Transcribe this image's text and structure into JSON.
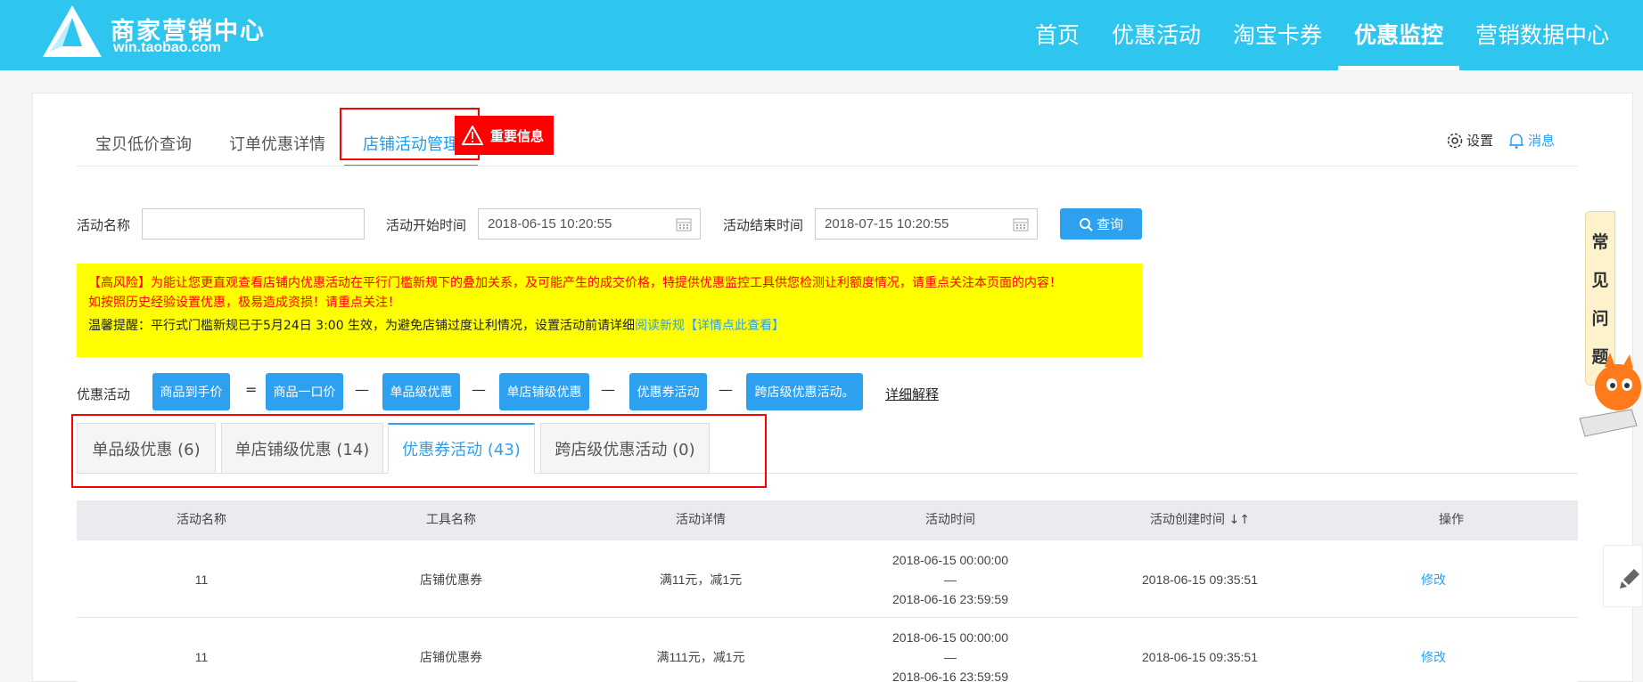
{
  "header": {
    "logo_title": "商家营销中心",
    "logo_sub": "win.taobao.com",
    "nav": [
      {
        "label": "首页",
        "active": false
      },
      {
        "label": "优惠活动",
        "active": false
      },
      {
        "label": "淘宝卡券",
        "active": false
      },
      {
        "label": "优惠监控",
        "active": true
      },
      {
        "label": "营销数据中心",
        "active": false
      }
    ]
  },
  "top_tabs": [
    {
      "label": "宝贝低价查询"
    },
    {
      "label": "订单优惠详情"
    },
    {
      "label": "店铺活动管理"
    }
  ],
  "important_badge": "重要信息",
  "toolbar": {
    "settings": "设置",
    "messages": "消息"
  },
  "search": {
    "name_label": "活动名称",
    "name_value": "",
    "start_label": "活动开始时间",
    "start_value": "2018-06-15 10:20:55",
    "end_label": "活动结束时间",
    "end_value": "2018-07-15 10:20:55",
    "query_button": "查询"
  },
  "notice": {
    "risk_line1": "【高风险】为能让您更直观查看店铺内优惠活动在平行门槛新规下的叠加关系，及可能产生的成交价格，特提供优惠监控工具供您检测让利额度情况，请重点关注本页面的内容！",
    "risk_line2": "如按照历史经验设置优惠，极易造成资损！请重点关注！",
    "tip_prefix": "温馨提醒：平行式门槛新规已于5月24日 3:00 生效，为避免店铺过度让利情况，设置活动前请详细",
    "tip_link1": "阅读新规",
    "tip_link2": "【详情点此查看】"
  },
  "discount_formula": {
    "label": "优惠活动",
    "chips": [
      "商品到手价",
      "商品一口价",
      "单品级优惠",
      "单店铺级优惠",
      "优惠券活动",
      "跨店级优惠活动。"
    ],
    "ops": [
      "=",
      "—",
      "—",
      "—",
      "—"
    ],
    "detail_link": "详细解释"
  },
  "sub_tabs": [
    {
      "label": "单品级优惠 (6)",
      "active": false
    },
    {
      "label": "单店铺级优惠 (14)",
      "active": false
    },
    {
      "label": "优惠券活动 (43)",
      "active": true
    },
    {
      "label": "跨店级优惠活动 (0)",
      "active": false
    }
  ],
  "table": {
    "headers": [
      "活动名称",
      "工具名称",
      "活动详情",
      "活动时间",
      "活动创建时间 ↓↑",
      "操作"
    ],
    "rows": [
      {
        "name": "11",
        "tool": "店铺优惠券",
        "detail": "满11元，减1元",
        "time_start": "2018-06-15 00:00:00",
        "time_sep": "—",
        "time_end": "2018-06-16 23:59:59",
        "created": "2018-06-15 09:35:51",
        "action": "修改"
      },
      {
        "name": "11",
        "tool": "店铺优惠券",
        "detail": "满111元，减1元",
        "time_start": "2018-06-15 00:00:00",
        "time_sep": "—",
        "time_end": "2018-06-16 23:59:59",
        "created": "2018-06-15 09:35:51",
        "action": "修改"
      }
    ]
  },
  "faq": [
    "常",
    "见",
    "问",
    "题"
  ],
  "colors": {
    "brand": "#2ec6ef",
    "accent": "#2ea0f0",
    "warning": "#ff0000",
    "notice_bg": "#ffff00"
  }
}
